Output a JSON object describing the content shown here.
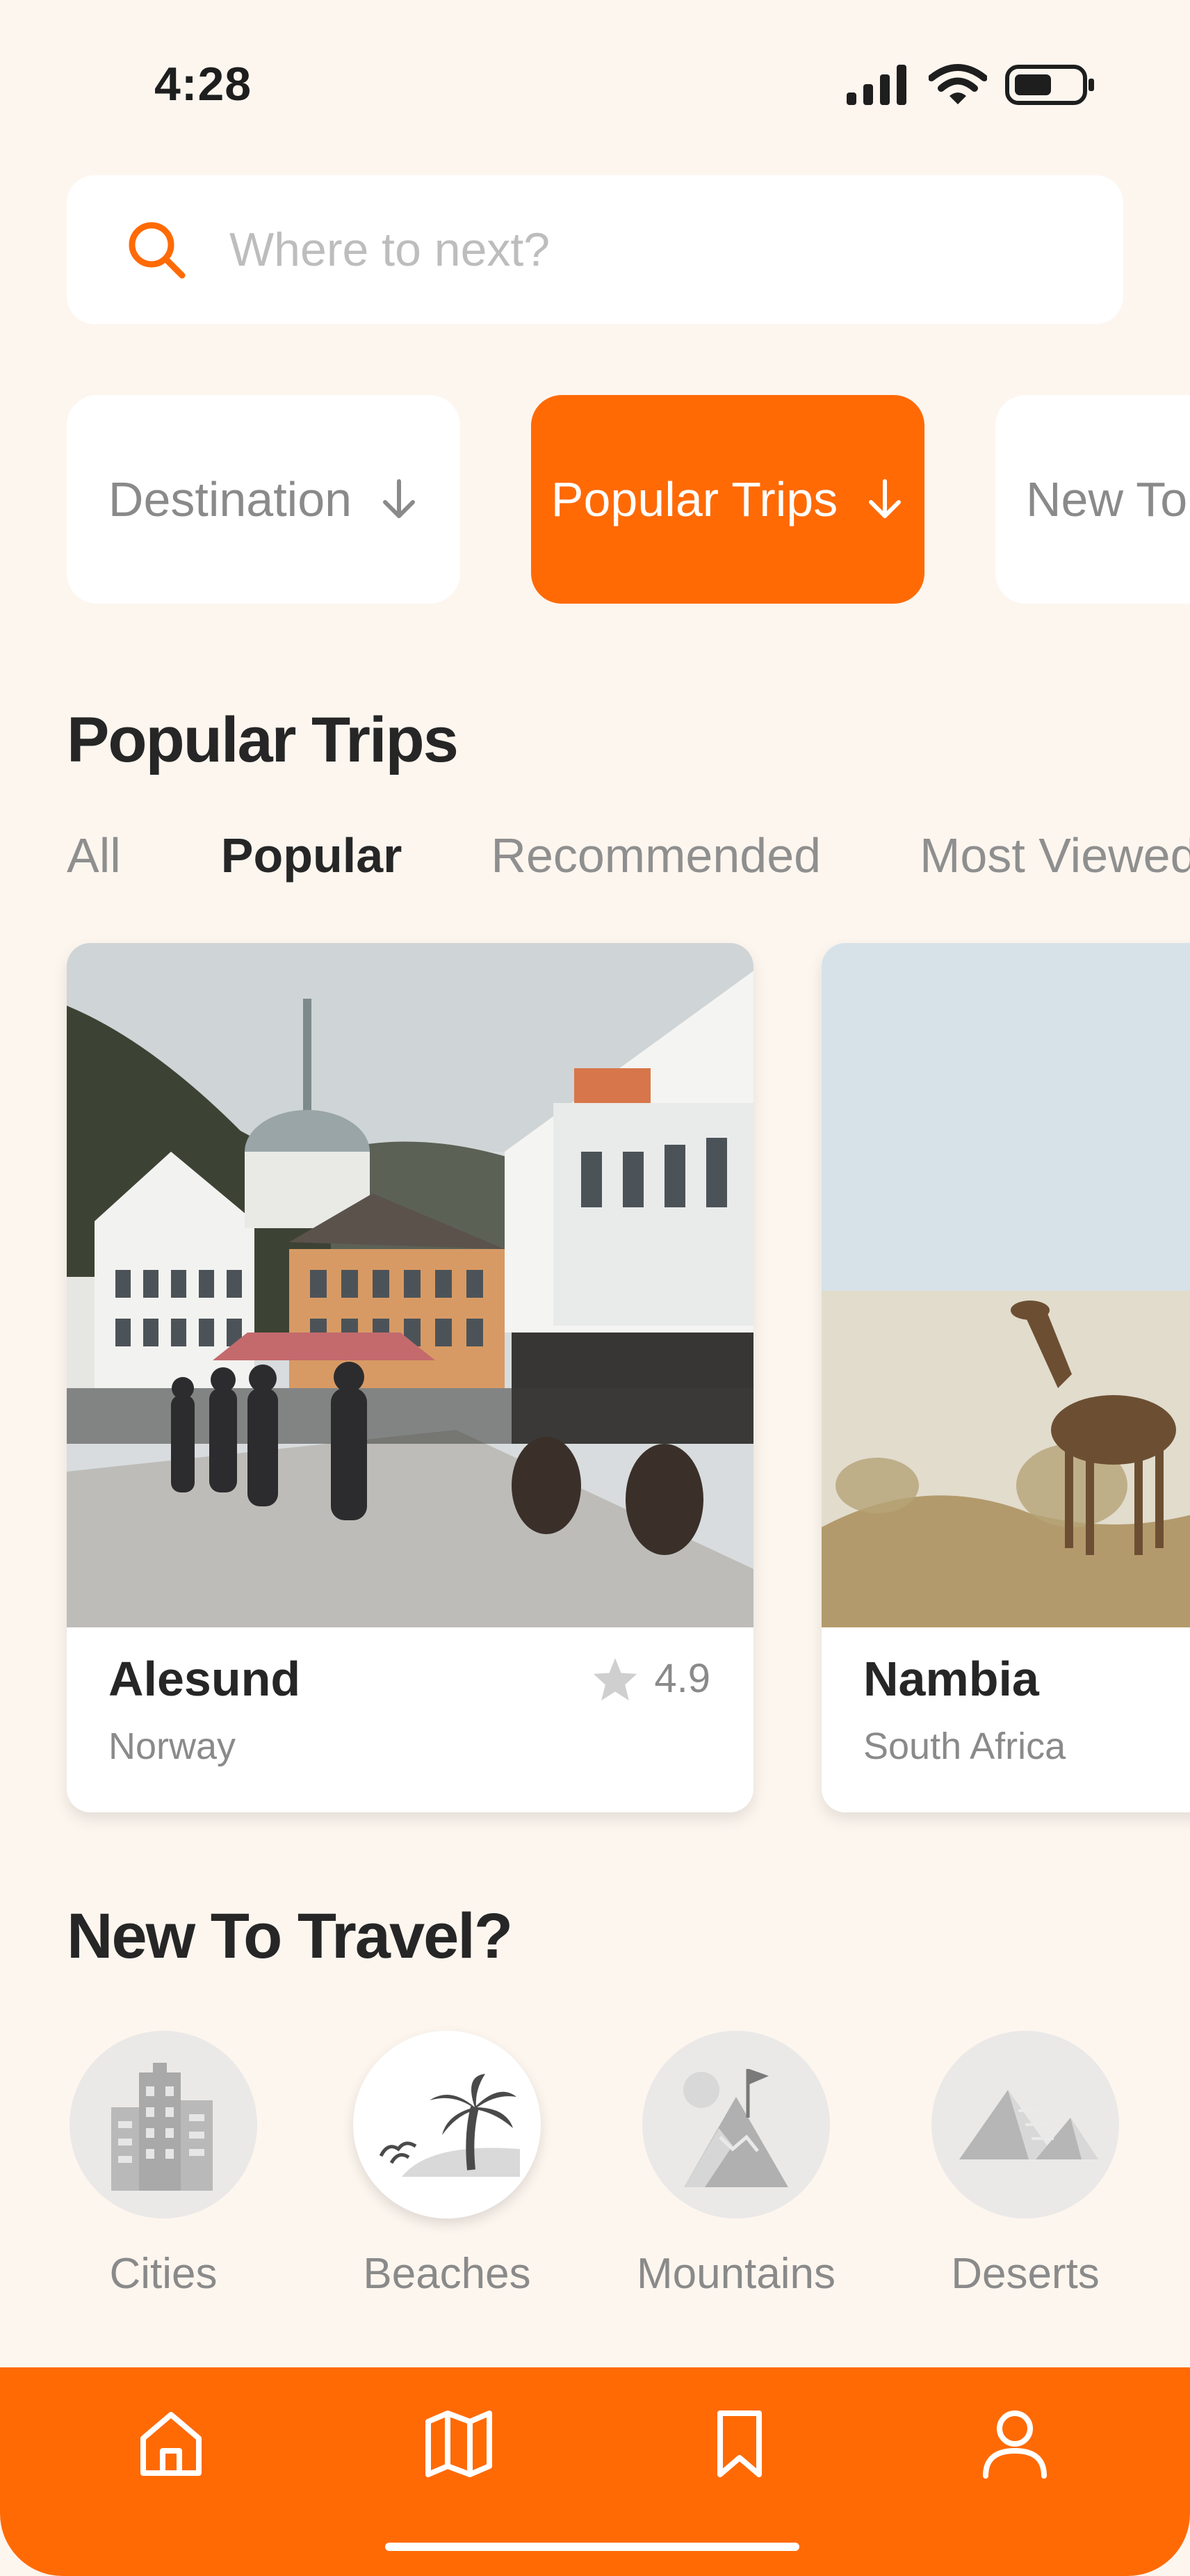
{
  "status_bar": {
    "time": "4:28"
  },
  "search": {
    "placeholder": "Where to next?"
  },
  "chips": [
    {
      "label": "Destination",
      "active": false
    },
    {
      "label": "Popular Trips",
      "active": true
    },
    {
      "label": "New To",
      "active": false
    }
  ],
  "popular_section": {
    "title": "Popular Trips",
    "tabs": [
      {
        "label": "All",
        "active": false
      },
      {
        "label": "Popular",
        "active": true
      },
      {
        "label": "Recommended",
        "active": false
      },
      {
        "label": "Most Viewed",
        "active": false
      }
    ]
  },
  "trips": [
    {
      "name": "Alesund",
      "country": "Norway",
      "rating": "4.9"
    },
    {
      "name": "Nambia",
      "country": "South Africa"
    }
  ],
  "new_to_travel": {
    "title": "New To Travel?",
    "categories": [
      {
        "label": "Cities",
        "icon": "city-buildings-icon",
        "active": false
      },
      {
        "label": "Beaches",
        "icon": "palm-tree-beach-icon",
        "active": true
      },
      {
        "label": "Mountains",
        "icon": "mountain-flag-icon",
        "active": false
      },
      {
        "label": "Deserts",
        "icon": "pyramids-icon",
        "active": false
      }
    ]
  },
  "bottom_nav": {
    "items": [
      "home-icon",
      "map-icon",
      "bookmark-icon",
      "profile-icon"
    ]
  },
  "colors": {
    "accent": "#ff6a05",
    "background": "#fdf6ef",
    "muted_text": "#8a8a8a"
  }
}
